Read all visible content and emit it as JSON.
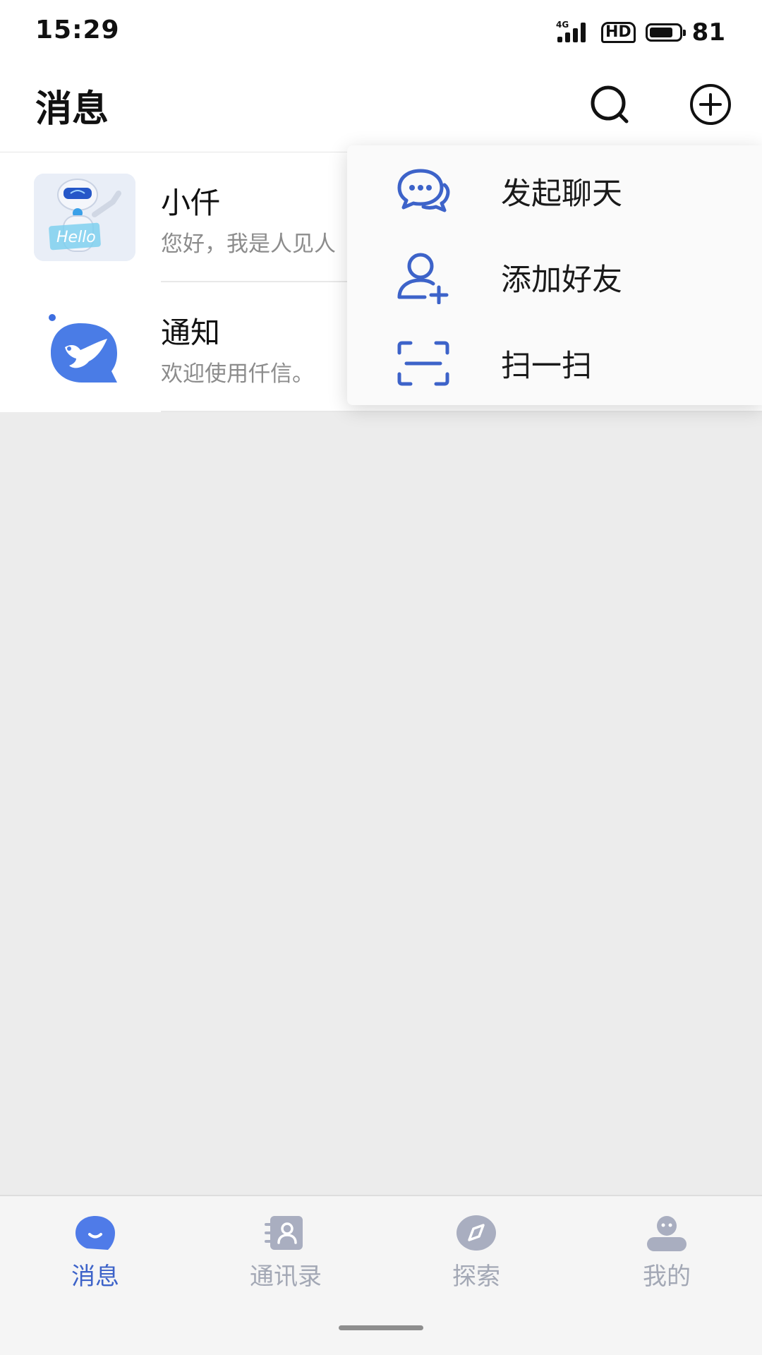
{
  "status_bar": {
    "time": "15:29",
    "network": "4G",
    "hd": "HD",
    "battery": "81",
    "battery_fraction": 0.81
  },
  "header": {
    "title": "消息",
    "search_icon": "search-icon",
    "add_icon": "plus-circle-icon"
  },
  "conversations": [
    {
      "name": "小仟",
      "preview": "您好，我是人见人",
      "avatar": "robot-hello-avatar",
      "avatar_text": "Hello"
    },
    {
      "name": "通知",
      "preview": "欢迎使用仟信。",
      "avatar": "dove-bubble-avatar"
    }
  ],
  "menu": {
    "items": [
      {
        "label": "发起聊天",
        "icon": "chat-bubbles-icon"
      },
      {
        "label": "添加好友",
        "icon": "add-user-icon"
      },
      {
        "label": "扫一扫",
        "icon": "scan-icon"
      }
    ],
    "accent": "#3d63c9"
  },
  "bottom_nav": {
    "items": [
      {
        "label": "消息",
        "icon": "message-icon",
        "active": true
      },
      {
        "label": "通讯录",
        "icon": "contacts-icon",
        "active": false
      },
      {
        "label": "探索",
        "icon": "compass-icon",
        "active": false
      },
      {
        "label": "我的",
        "icon": "profile-icon",
        "active": false
      }
    ]
  }
}
